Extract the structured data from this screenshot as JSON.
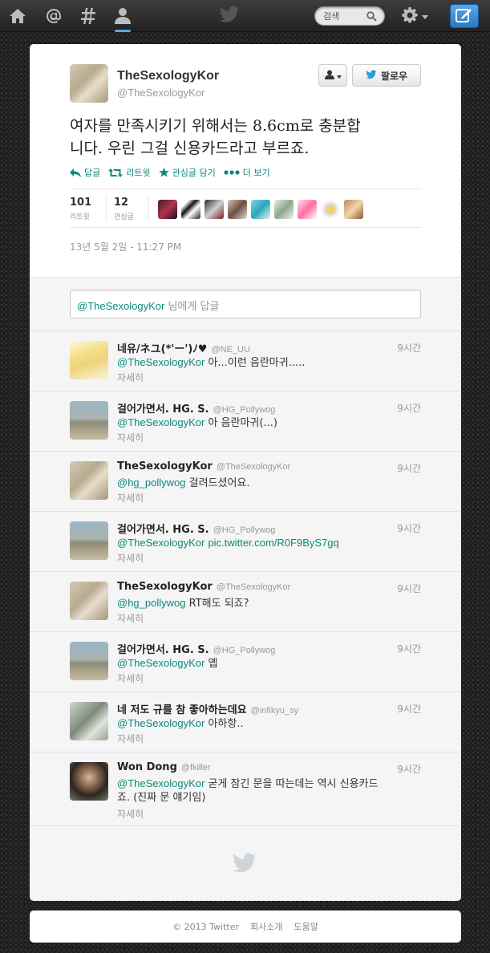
{
  "nav": {
    "search_placeholder": "검색",
    "icons": [
      "home-icon",
      "mentions-icon",
      "discover-icon",
      "profile-icon",
      "twitter-bird-icon",
      "search-icon",
      "gear-icon",
      "compose-icon"
    ]
  },
  "tweet": {
    "author_name": "TheSexologyKor",
    "author_handle": "@TheSexologyKor",
    "follow_label": "팔로우",
    "text_line1": "여자를 만족시키기 위해서는 8.6cm로 충분합",
    "text_line2": "니다. 우린 그걸 신용카드라고 부르죠.",
    "actions": {
      "reply": "답글",
      "retweet": "리트윗",
      "favorite": "관심글 담기",
      "more": "더 보기"
    },
    "retweets_count": "101",
    "retweets_label": "리트윗",
    "favorites_count": "12",
    "favorites_label": "관심글",
    "timestamp": "13년 5월 2일 - 11:27 PM"
  },
  "reply_box": {
    "handle": "@TheSexologyKor",
    "suffix": " 님에게 답글"
  },
  "replies": [
    {
      "name": "네유/ネユ(*'ー')ﾉ♥",
      "handle": "@NE_UU",
      "time": "9시간",
      "mention": "@TheSexologyKor",
      "text": " 아...이런 음란마귀.....",
      "detail": "자세히"
    },
    {
      "name": "걸어가면서. HG. S.",
      "handle": "@HG_Pollywog",
      "time": "9시간",
      "mention": "@TheSexologyKor",
      "text": " 아 음란마귀(...)",
      "detail": "자세히"
    },
    {
      "name": "TheSexologyKor",
      "handle": "@TheSexologyKor",
      "time": "9시간",
      "mention": "@hg_pollywog",
      "text": " 걸려드셨어요.",
      "detail": "자세히"
    },
    {
      "name": "걸어가면서. HG. S.",
      "handle": "@HG_Pollywog",
      "time": "9시간",
      "mention": "@TheSexologyKor",
      "link": "pic.twitter.com/R0F9ByS7gq",
      "text": "",
      "detail": "자세히"
    },
    {
      "name": "TheSexologyKor",
      "handle": "@TheSexologyKor",
      "time": "9시간",
      "mention": "@hg_pollywog",
      "text": " RT해도 되죠?",
      "detail": "자세히"
    },
    {
      "name": "걸어가면서. HG. S.",
      "handle": "@HG_Pollywog",
      "time": "9시간",
      "mention": "@TheSexologyKor",
      "text": " 옙",
      "detail": "자세히"
    },
    {
      "name": "네 저도 규를 참 좋아하는데요",
      "handle": "@infikyu_sy",
      "time": "9시간",
      "mention": "@TheSexologyKor",
      "text": " 아하항..",
      "detail": "자세히"
    },
    {
      "name": "Won Dong",
      "handle": "@fkiller",
      "time": "9시간",
      "mention": "@TheSexologyKor",
      "text": " 굳게 잠긴 문을 따는데는 역시 신용카드",
      "text2": "죠. (진짜 문 얘기임)",
      "detail": "자세히"
    }
  ],
  "footer": {
    "copyright": "© 2013 Twitter",
    "about": "회사소개",
    "help": "도움말"
  },
  "colors": {
    "accent": "#0a8a7a",
    "compose_blue": "#2a78c2",
    "nav_active": "#5ea9dd"
  }
}
